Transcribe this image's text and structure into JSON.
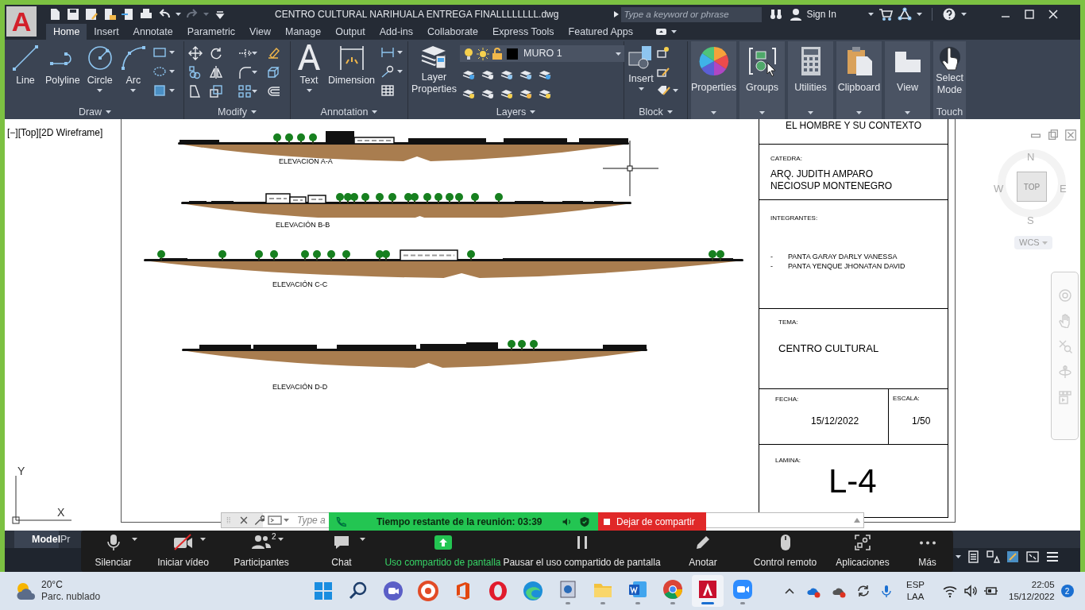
{
  "app_menu": {
    "logo": "A"
  },
  "window": {
    "title": "CENTRO CULTURAL NARIHUALA ENTREGA FINALLLLLLLL.dwg"
  },
  "search": {
    "placeholder": "Type a keyword or phrase"
  },
  "account": {
    "label": "Sign In"
  },
  "ribbon_tabs": [
    {
      "label": "Home",
      "selected": true
    },
    {
      "label": "Insert",
      "selected": false
    },
    {
      "label": "Annotate",
      "selected": false
    },
    {
      "label": "Parametric",
      "selected": false
    },
    {
      "label": "View",
      "selected": false
    },
    {
      "label": "Manage",
      "selected": false
    },
    {
      "label": "Output",
      "selected": false
    },
    {
      "label": "Add-ins",
      "selected": false
    },
    {
      "label": "Collaborate",
      "selected": false
    },
    {
      "label": "Express Tools",
      "selected": false
    },
    {
      "label": "Featured Apps",
      "selected": false
    }
  ],
  "ribbon": {
    "draw": {
      "title": "Draw",
      "tools": [
        "Line",
        "Polyline",
        "Circle",
        "Arc"
      ]
    },
    "modify": {
      "title": "Modify"
    },
    "annotation": {
      "title": "Annotation",
      "tools": [
        "Text",
        "Dimension"
      ]
    },
    "layers": {
      "title": "Layers",
      "tool": "Layer Properties",
      "current_layer": "MURO 1"
    },
    "block": {
      "title": "Block",
      "tool": "Insert"
    },
    "panels": [
      "Properties",
      "Groups",
      "Utilities",
      "Clipboard",
      "View"
    ],
    "touch": {
      "title": "Touch",
      "tool": "Select Mode"
    }
  },
  "viewport": {
    "label": "[−][Top][2D Wireframe]"
  },
  "drawing": {
    "elevations": [
      "ELEVACION A-A",
      "ELEVACIÓN B-B",
      "ELEVACIÓN C-C",
      "ELEVACIÓN  D-D"
    ]
  },
  "title_block": {
    "course": "EL HOMBRE Y SU CONTEXTO",
    "chair_label": "CATEDRA:",
    "chair_lines": [
      "ARQ. JUDITH AMPARO",
      "NECIOSUP MONTENEGRO"
    ],
    "members_label": "INTEGRANTES:",
    "members": [
      {
        "bullet": "-",
        "name": "PANTA GARAY DARLY VANESSA"
      },
      {
        "bullet": "-",
        "name": "PANTA YENQUE JHONATAN DAVID"
      }
    ],
    "topic_label": "TEMA:",
    "topic": "CENTRO CULTURAL",
    "date_label": "FECHA:",
    "date": "15/12/2022",
    "scale_label": "ESCALA:",
    "scale": "1/50",
    "sheet_label": "LAMINA:",
    "sheet": "L-4"
  },
  "viewcube": {
    "north": "N",
    "west": "W",
    "face": "TOP",
    "east": "E",
    "south": "S",
    "ucs_menu": "WCS"
  },
  "ucs_icon": {
    "y": "Y",
    "x": "X"
  },
  "command_line": {
    "placeholder": "Type a"
  },
  "layout_tabs": [
    {
      "label": "Model",
      "selected": true
    },
    {
      "label": "Pr",
      "selected": false
    }
  ],
  "meeting": {
    "time_left": "Tiempo restante de la reunión: 03:39",
    "stop_share": "Dejar de compartir",
    "controls": [
      {
        "label": "Silenciar",
        "caret": true,
        "highlighted": false
      },
      {
        "label": "Iniciar vídeo",
        "caret": true,
        "highlighted": false
      },
      {
        "label": "Participantes",
        "caret": true,
        "highlighted": false,
        "count": "2"
      },
      {
        "label": "Chat",
        "caret": true,
        "highlighted": false
      },
      {
        "label": "Uso compartido de pantalla",
        "caret": false,
        "highlighted": true
      },
      {
        "label": "Pausar el uso compartido de pantalla",
        "caret": false,
        "highlighted": false
      },
      {
        "label": "Anotar",
        "caret": false,
        "highlighted": false
      },
      {
        "label": "Control remoto",
        "caret": false,
        "highlighted": false
      },
      {
        "label": "Aplicaciones",
        "caret": false,
        "highlighted": false
      },
      {
        "label": "Más",
        "caret": false,
        "highlighted": false
      }
    ]
  },
  "taskbar": {
    "temperature": "20°C",
    "weather": "Parc. nublado",
    "language": "ESP",
    "region": "LAA",
    "time": "22:05",
    "date": "15/12/2022",
    "notifications": "2"
  }
}
